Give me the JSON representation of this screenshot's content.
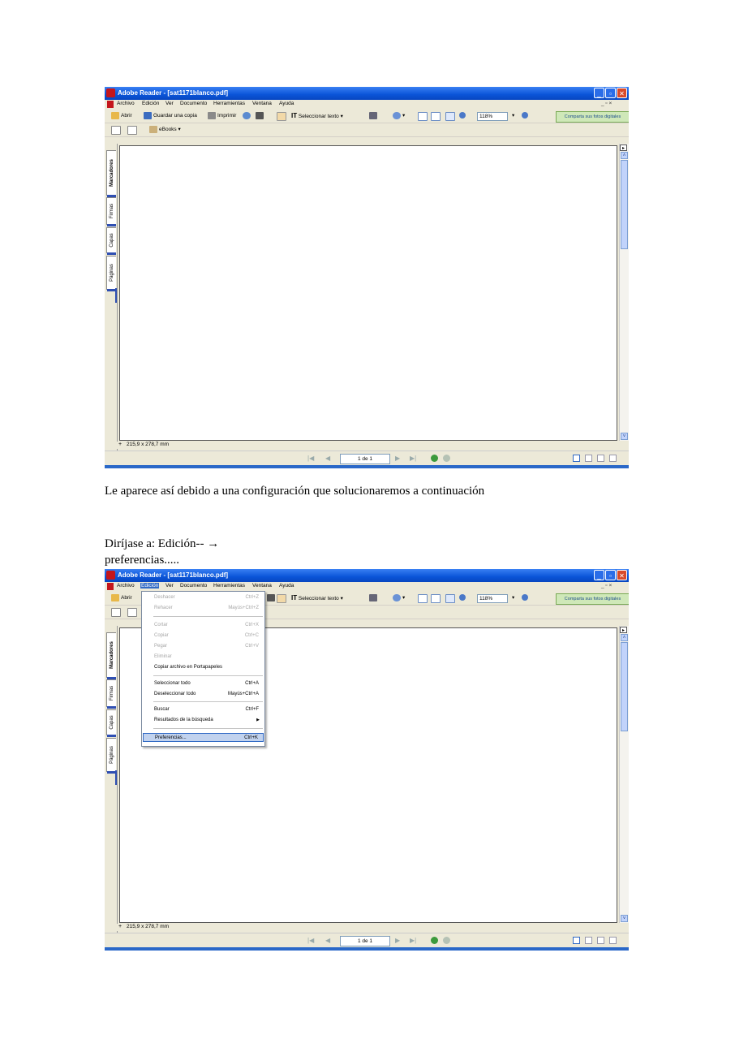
{
  "app": {
    "title": "Adobe Reader - [sat1171blanco.pdf]",
    "window_buttons": [
      "_",
      "▫",
      "✕"
    ],
    "doc_controls": "_ ▫ ×"
  },
  "menu": [
    "Archivo",
    "Edición",
    "Ver",
    "Documento",
    "Herramientas",
    "Ventana",
    "Ayuda"
  ],
  "toolbar": {
    "open": "Abrir",
    "save_copy": "Guardar una copia",
    "print": "Imprimir",
    "select_text": "Seleccionar texto",
    "zoom": "118%",
    "promo": "Comparta sus fotos digitales",
    "ebooks": "eBooks"
  },
  "nav_tabs": [
    "Marcadores",
    "Firmas",
    "Capas",
    "Páginas"
  ],
  "page_size": "215,9 x 278,7 mm",
  "page_indicator": "1 de 1",
  "edit_menu": {
    "items": [
      {
        "label": "Deshacer",
        "shortcut": "Ctrl+Z",
        "disabled": true
      },
      {
        "label": "Rehacer",
        "shortcut": "Mayús+Ctrl+Z",
        "disabled": true
      },
      {
        "label": "Cortar",
        "shortcut": "Ctrl+X",
        "disabled": true
      },
      {
        "label": "Copiar",
        "shortcut": "Ctrl+C",
        "disabled": true
      },
      {
        "label": "Pegar",
        "shortcut": "Ctrl+V",
        "disabled": true
      },
      {
        "label": "Eliminar",
        "shortcut": "",
        "disabled": true
      },
      {
        "label": "Copiar archivo en Portapapeles",
        "shortcut": "",
        "disabled": false
      },
      {
        "label": "Seleccionar todo",
        "shortcut": "Ctrl+A",
        "disabled": false
      },
      {
        "label": "Deseleccionar todo",
        "shortcut": "Mayús+Ctrl+A",
        "disabled": false
      },
      {
        "label": "Buscar",
        "shortcut": "Ctrl+F",
        "disabled": false
      },
      {
        "label": "Resultados de la búsqueda",
        "shortcut": "",
        "disabled": false,
        "submenu": true
      },
      {
        "label": "Preferencias...",
        "shortcut": "Ctrl+K",
        "disabled": false,
        "selected": true
      }
    ]
  },
  "text": {
    "line1": "Le aparece así debido a una configuración que solucionaremos a continuación",
    "line2": "Diríjase a:    Edición-- →",
    "line3": "preferencias....."
  }
}
